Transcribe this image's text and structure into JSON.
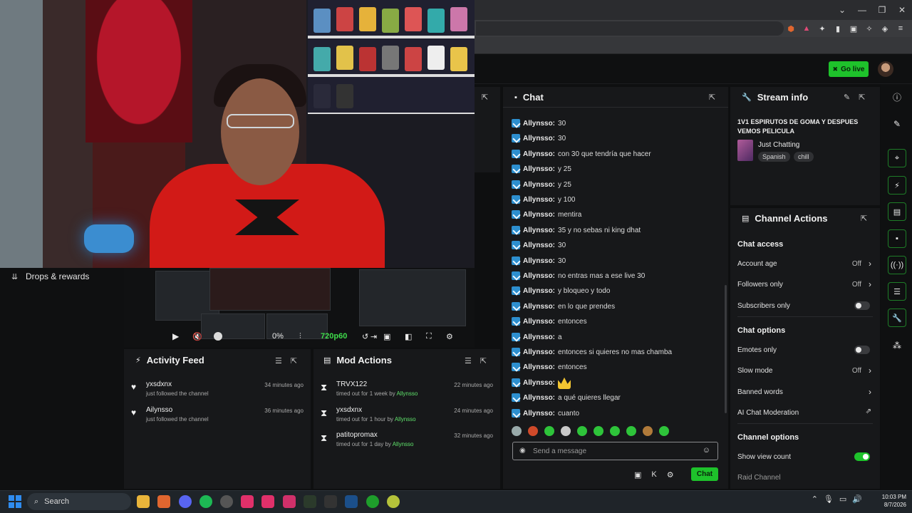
{
  "window": {
    "minimize": "⌄",
    "restore": "—",
    "maximize": "❐",
    "close": "✕"
  },
  "topbar": {
    "go_live_label": "Go live"
  },
  "left": {
    "drops_label": "Drops & rewards"
  },
  "player": {
    "volume_percent": "0%",
    "quality": "720p60"
  },
  "activity_feed": {
    "title": "Activity Feed",
    "items": [
      {
        "name": "yxsdxnx",
        "sub": "just followed the channel",
        "time": "34 minutes ago"
      },
      {
        "name": "Ailynsso",
        "sub": "just followed the channel",
        "time": "36 minutes ago"
      }
    ]
  },
  "mod_actions": {
    "title": "Mod Actions",
    "items": [
      {
        "name": "TRVX122",
        "action": "timed out for 1 week by",
        "by": "Allynsso",
        "time": "22 minutes ago"
      },
      {
        "name": "yxsdxnx",
        "action": "timed out for 1 hour by",
        "by": "Allynsso",
        "time": "24 minutes ago"
      },
      {
        "name": "patitopromax",
        "action": "timed out for 1 day by",
        "by": "Allynsso",
        "time": "32 minutes ago"
      }
    ]
  },
  "chat": {
    "title": "Chat",
    "messages": [
      {
        "user": "Allynsso:",
        "text": "30"
      },
      {
        "user": "Allynsso:",
        "text": "30"
      },
      {
        "user": "Allynsso:",
        "text": "con 30 que tendría que hacer"
      },
      {
        "user": "Allynsso:",
        "text": "y 25"
      },
      {
        "user": "Allynsso:",
        "text": "y 25"
      },
      {
        "user": "Allynsso:",
        "text": "y 100"
      },
      {
        "user": "Allynsso:",
        "text": "mentira"
      },
      {
        "user": "Allynsso:",
        "text": "35 y no sebas ni king dhat"
      },
      {
        "user": "Allynsso:",
        "text": "30"
      },
      {
        "user": "Allynsso:",
        "text": "30"
      },
      {
        "user": "Allynsso:",
        "text": "no entras mas a ese live 30"
      },
      {
        "user": "Allynsso:",
        "text": "y bloqueo y todo"
      },
      {
        "user": "Allynsso:",
        "text": "en lo que prendes"
      },
      {
        "user": "Allynsso:",
        "text": "entonces"
      },
      {
        "user": "Allynsso:",
        "text": "a"
      },
      {
        "user": "Allynsso:",
        "text": "entonces si quieres no mas chamba"
      },
      {
        "user": "Allynsso:",
        "text": "entonces"
      },
      {
        "user": "Allynsso:",
        "text": ""
      },
      {
        "user": "Allynsso:",
        "text": "a qué quieres llegar"
      },
      {
        "user": "Allynsso:",
        "text": "cuanto"
      }
    ],
    "input_placeholder": "Send a message",
    "send_label": "Chat"
  },
  "stream_info": {
    "title": "Stream info",
    "stream_title": "1V1 ESPIRUTOS DE GOMA Y DESPUES VEMOS PELICULA",
    "category": "Just Chatting",
    "tags": [
      "Spanish",
      "chill"
    ]
  },
  "channel_actions": {
    "title": "Channel Actions",
    "chat_access": "Chat access",
    "account_age": {
      "label": "Account age",
      "value": "Off"
    },
    "followers_only": {
      "label": "Followers only",
      "value": "Off"
    },
    "subscribers_only": {
      "label": "Subscribers only",
      "on": false
    },
    "chat_options": "Chat options",
    "emotes_only": {
      "label": "Emotes only",
      "on": false
    },
    "slow_mode": {
      "label": "Slow mode",
      "value": "Off"
    },
    "banned_words": "Banned words",
    "ai_moderation": "AI Chat Moderation",
    "channel_options": "Channel options",
    "show_view_count": {
      "label": "Show view count",
      "on": true
    },
    "raid_channel": "Raid Channel"
  },
  "taskbar": {
    "search_label": "Search",
    "time": "10:03 PM",
    "date": "8/7/2026"
  },
  "colors": {
    "accent": "#1ec22b",
    "panel": "#17181a",
    "background": "#0e0f10"
  }
}
